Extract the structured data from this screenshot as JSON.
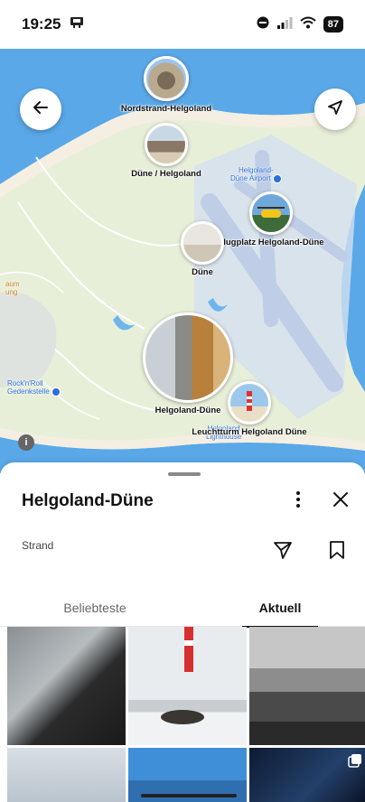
{
  "status_bar": {
    "time": "19:25",
    "battery": "87"
  },
  "map": {
    "pins": [
      {
        "name": "Nordstrand-Helgoland"
      },
      {
        "name": "Düne / Helgoland"
      },
      {
        "name": "Flugplatz Helgoland-Düne"
      },
      {
        "name": "Düne"
      },
      {
        "name": "Helgoland-Düne"
      },
      {
        "name": "Leuchtturm Helgoland Düne"
      }
    ],
    "pois": {
      "airport": "Helgoland-\nDüne Airport",
      "lighthouse": "Helgoland\nLighthouse",
      "gedenkstelle": "Rock'n'Roll\nGedenkstelle",
      "museum": "aum\nung"
    },
    "colors": {
      "sea": "#5aa8e8",
      "land": "#e8efd9",
      "beach": "#f4efe2",
      "airport": "#d5e0f0"
    }
  },
  "sheet": {
    "title": "Helgoland-Düne",
    "category": "Strand",
    "tabs": [
      {
        "label": "Beliebteste",
        "active": false
      },
      {
        "label": "Aktuell",
        "active": true
      }
    ]
  },
  "icons": {
    "back": "arrow-left-icon",
    "locate": "navigation-arrow-icon",
    "more": "vertical-dots-icon",
    "close": "close-icon",
    "share": "send-icon",
    "save": "bookmark-icon"
  }
}
